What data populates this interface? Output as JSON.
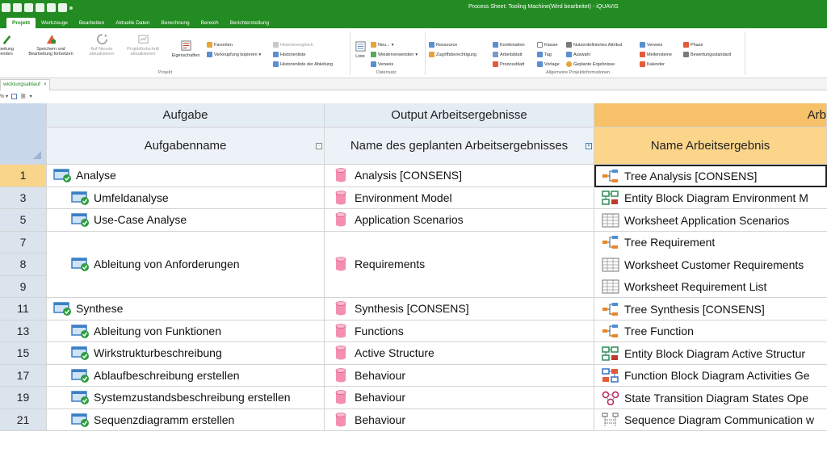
{
  "window": {
    "title": "Process Sheet: Tooling Machine(Wird bearbeitet) - iQUAVIS"
  },
  "menu_tabs": [
    "Projekt",
    "Werkzeuge",
    "Bearbeiten",
    "Aktuelle Daten",
    "Berechnung",
    "Bereich",
    "Berichterstellung"
  ],
  "ribbon": {
    "big_buttons": [
      {
        "label": "beitung\nenden",
        "icon": "pencil-icon"
      },
      {
        "label": "Speichern und\nBearbeitung fortsetzen",
        "icon": "save-continue-icon"
      },
      {
        "label": "Auf Neuste\naktualisieren",
        "icon": "refresh-icon"
      },
      {
        "label": "Projektfortschritt\naktualisieren",
        "icon": "progress-icon"
      },
      {
        "label": "Eigenschaften",
        "icon": "properties-icon"
      },
      {
        "label": "Liste",
        "icon": "list-icon"
      }
    ],
    "favorites": [
      "Favoriten",
      "Verknüpfung kopieren",
      "Historievergleich",
      "Historienliste",
      "Historienliste der Ableitung"
    ],
    "dataset": [
      "Neu...",
      "Wiederverwenden",
      "Verweis"
    ],
    "resources": [
      "Ressource",
      "Zugriffsberechtigung"
    ],
    "combo": [
      "Kombination",
      "Arbeitsblatt",
      "Prozessblatt"
    ],
    "klasse": [
      "Klasse",
      "Tag",
      "Vorlage"
    ],
    "attrib": [
      "Nutzerdefiniertes Attribut",
      "Auswahl",
      "Geplante Ergebnisse"
    ],
    "verweis": [
      "Verweis",
      "Meilensteine",
      "Kalender"
    ],
    "phase": [
      "Phase",
      "Bewertungsstandard"
    ],
    "group_labels": {
      "projekt": "Projekt",
      "datensatz": "Datensatz",
      "allgemein": "Allgemeine Projektinformationen"
    }
  },
  "document_tab": {
    "label": "wicklungsablauf",
    "close": "×"
  },
  "mini_toolbar": "% ▾",
  "grid": {
    "group_headers": {
      "task": "Aufgabe",
      "output": "Output Arbeitsergebnisse",
      "work": "Arb"
    },
    "column_headers": {
      "task": "Aufgabenname",
      "output": "Name des geplanten Arbeitsergebnisses",
      "work": "Name Arbeitsergebnis"
    },
    "rows": [
      {
        "nums": [
          "1"
        ],
        "task": "Analyse",
        "level": 0,
        "output": "Analysis [CONSENS]",
        "works": [
          {
            "text": "Tree Analysis [CONSENS]",
            "icon": "tree-icon"
          }
        ],
        "selected": true
      },
      {
        "nums": [
          "3"
        ],
        "task": "Umfeldanalyse",
        "level": 1,
        "output": "Environment Model",
        "works": [
          {
            "text": "Entity Block Diagram Environment M",
            "icon": "entity-block-icon"
          }
        ]
      },
      {
        "nums": [
          "5"
        ],
        "task": "Use-Case Analyse",
        "level": 1,
        "output": "Application Scenarios",
        "works": [
          {
            "text": "Worksheet Application Scenarios",
            "icon": "worksheet-icon"
          }
        ]
      },
      {
        "nums": [
          "7",
          "8",
          "9"
        ],
        "task": "Ableitung von Anforderungen",
        "level": 1,
        "output": "Requirements",
        "works": [
          {
            "text": "Tree Requirement",
            "icon": "tree-icon"
          },
          {
            "text": "Worksheet Customer Requirements",
            "icon": "worksheet-icon"
          },
          {
            "text": "Worksheet Requirement List",
            "icon": "worksheet-icon"
          }
        ]
      },
      {
        "nums": [
          "11"
        ],
        "task": "Synthese",
        "level": 0,
        "output": "Synthesis [CONSENS]",
        "works": [
          {
            "text": "Tree Synthesis [CONSENS]",
            "icon": "tree-icon"
          }
        ]
      },
      {
        "nums": [
          "13"
        ],
        "task": "Ableitung von Funktionen",
        "level": 1,
        "output": "Functions",
        "works": [
          {
            "text": "Tree Function",
            "icon": "tree-icon"
          }
        ]
      },
      {
        "nums": [
          "15"
        ],
        "task": "Wirkstrukturbeschreibung",
        "level": 1,
        "output": "Active Structure",
        "works": [
          {
            "text": "Entity Block Diagram Active Structur",
            "icon": "entity-block-icon"
          }
        ]
      },
      {
        "nums": [
          "17"
        ],
        "task": "Ablaufbeschreibung erstellen",
        "level": 1,
        "output": "Behaviour",
        "works": [
          {
            "text": "Function Block Diagram Activities Ge",
            "icon": "function-block-icon"
          }
        ]
      },
      {
        "nums": [
          "19"
        ],
        "task": "Systemzustandsbeschreibung erstellen",
        "level": 1,
        "output": "Behaviour",
        "works": [
          {
            "text": "State Transition Diagram States Ope",
            "icon": "state-transition-icon"
          }
        ]
      },
      {
        "nums": [
          "21"
        ],
        "task": "Sequenzdiagramm erstellen",
        "level": 1,
        "output": "Behaviour",
        "works": [
          {
            "text": "Sequence Diagram Communication w",
            "icon": "sequence-icon"
          }
        ]
      }
    ]
  },
  "colors": {
    "accent": "#228b22",
    "header_blue": "#e4ecf4",
    "header_orange": "#f7c169",
    "selected_row": "#f9d58c"
  }
}
